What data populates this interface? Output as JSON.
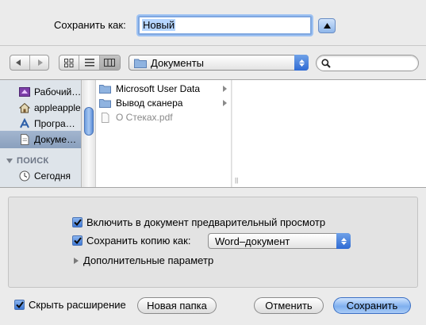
{
  "save_as": {
    "label": "Сохранить как:",
    "value": "Новый"
  },
  "toolbar": {
    "location": "Документы",
    "search_placeholder": ""
  },
  "sidebar": {
    "items": [
      {
        "label": "Рабочий…",
        "icon": "desktop-icon"
      },
      {
        "label": "appleapple",
        "icon": "home-icon"
      },
      {
        "label": "Програ…",
        "icon": "applications-icon"
      },
      {
        "label": "Докуме…",
        "icon": "documents-icon",
        "selected": true
      }
    ],
    "search_header": "ПОИСК",
    "search_items": [
      {
        "label": "Сегодня",
        "icon": "clock-icon"
      }
    ]
  },
  "browser": {
    "items": [
      {
        "label": "Microsoft User Data",
        "type": "folder"
      },
      {
        "label": "Вывод сканера",
        "type": "folder"
      },
      {
        "label": "О Стеках.pdf",
        "type": "file"
      }
    ]
  },
  "options": {
    "include_preview": {
      "label": "Включить в документ предварительный просмотр",
      "checked": true
    },
    "save_copy": {
      "label": "Сохранить копию как:",
      "checked": true
    },
    "format": "Word–документ",
    "more_options": "Дополнительные параметр"
  },
  "footer": {
    "hide_extension": {
      "label": "Скрыть расширение",
      "checked": true
    },
    "new_folder": "Новая папка",
    "cancel": "Отменить",
    "save": "Сохранить"
  },
  "colors": {
    "accent": "#3d78d6",
    "sidebar_bg": "#dee4ea",
    "dialog_bg": "#ebebeb"
  }
}
